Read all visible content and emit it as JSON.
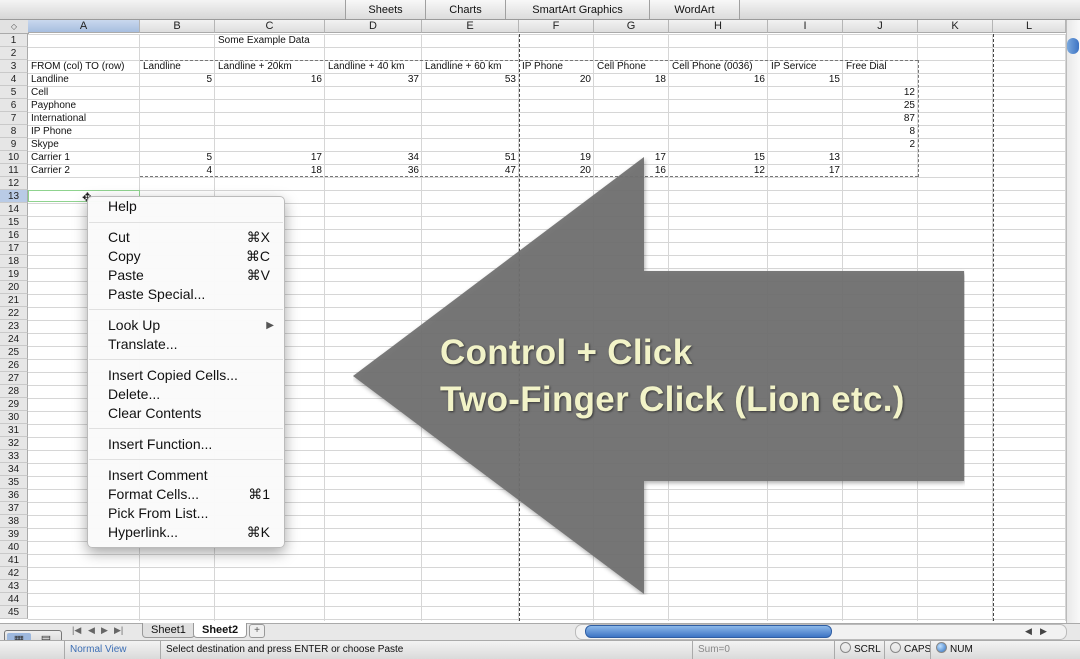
{
  "ribbon": {
    "tabs": [
      "Sheets",
      "Charts",
      "SmartArt Graphics",
      "WordArt"
    ]
  },
  "columns": [
    "A",
    "B",
    "C",
    "D",
    "E",
    "F",
    "G",
    "H",
    "I",
    "J",
    "K",
    "L"
  ],
  "rows": [
    "1",
    "2",
    "3",
    "4",
    "5",
    "6",
    "7",
    "8",
    "9",
    "10",
    "11",
    "12",
    "13",
    "14",
    "15",
    "16",
    "17",
    "18",
    "19",
    "20",
    "21",
    "22",
    "23",
    "24",
    "25",
    "26",
    "27",
    "28",
    "29",
    "30",
    "31",
    "32",
    "33",
    "34",
    "35",
    "36",
    "37",
    "38",
    "39",
    "40",
    "41",
    "42",
    "43",
    "44",
    "45"
  ],
  "sheet": {
    "title": "Some Example Data",
    "header_row": [
      "FROM (col) TO (row)",
      "Landline",
      "Landline + 20km",
      "Landline + 40 km",
      "Landline + 60 km",
      "IP Phone",
      "Cell Phone",
      "Cell Phone (0036)",
      "IP Service",
      "Free Dial"
    ],
    "row_labels": [
      "Landline",
      "Cell",
      "Payphone",
      "International",
      "IP Phone",
      "Skype",
      "Carrier 1",
      "Carrier 2"
    ],
    "landline_row": [
      "5",
      "16",
      "37",
      "53",
      "20",
      "18",
      "16",
      "15"
    ],
    "free_dial_col": [
      "12",
      "25",
      "87",
      "8",
      "2"
    ],
    "carrier1_row": [
      "5",
      "17",
      "34",
      "51",
      "19",
      "17",
      "15",
      "13"
    ],
    "carrier2_row": [
      "4",
      "18",
      "36",
      "47",
      "20",
      "16",
      "12",
      "17"
    ]
  },
  "overlay": {
    "line1": "Control + Click",
    "line2": "Two-Finger Click (Lion etc.)",
    "arrow_color": "#6f6f6f"
  },
  "context_menu": {
    "help": "Help",
    "cut": "Cut",
    "cut_sc": "⌘X",
    "copy": "Copy",
    "copy_sc": "⌘C",
    "paste": "Paste",
    "paste_sc": "⌘V",
    "paste_special": "Paste Special...",
    "look_up": "Look Up",
    "translate": "Translate...",
    "insert_copied": "Insert Copied Cells...",
    "delete": "Delete...",
    "clear_contents": "Clear Contents",
    "insert_function": "Insert Function...",
    "insert_comment": "Insert Comment",
    "format_cells": "Format Cells...",
    "format_cells_sc": "⌘1",
    "pick_from_list": "Pick From List...",
    "hyperlink": "Hyperlink...",
    "hyperlink_sc": "⌘K"
  },
  "tabs": {
    "sheet1": "Sheet1",
    "sheet2": "Sheet2"
  },
  "status": {
    "view": "Normal View",
    "message": "Select destination and press ENTER or choose Paste",
    "sum": "Sum=0",
    "scrl": "SCRL",
    "caps": "CAPS",
    "num": "NUM"
  }
}
